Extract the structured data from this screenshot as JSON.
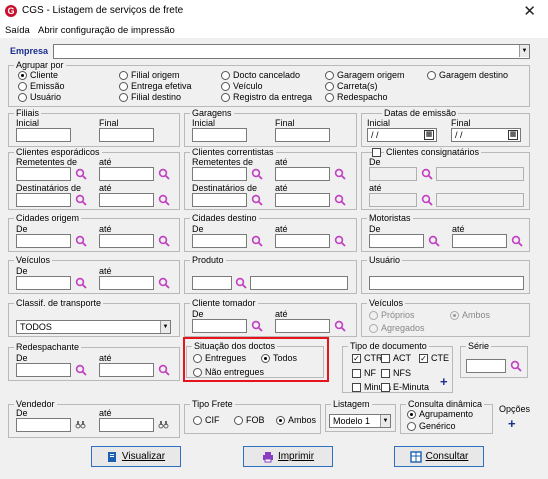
{
  "window": {
    "logo_letter": "G",
    "title": "CGS - Listagem de serviços de frete",
    "close": "✕"
  },
  "menu": {
    "items": [
      "Saída",
      "Abrir configuração de impressão"
    ]
  },
  "empresa": {
    "label": "Empresa",
    "value": ""
  },
  "agrupar": {
    "title": "Agrupar por",
    "options": [
      "Cliente",
      "Emissão",
      "Usuário",
      "Filial origem",
      "Entrega efetiva",
      "Filial destino",
      "Docto cancelado",
      "Veículo",
      "Registro da entrega",
      "Garagem origem",
      "Carreta(s)",
      "Redespacho",
      "Garagem destino"
    ],
    "selected": "Cliente"
  },
  "filiais": {
    "title": "Filiais",
    "inicial": "Inicial",
    "final": "Final"
  },
  "garagens": {
    "title": "Garagens",
    "inicial": "Inicial",
    "final": "Final"
  },
  "datas": {
    "title": "Datas de emissão",
    "inicial": "Inicial",
    "final": "Final",
    "inicial_value": "/ /",
    "final_value": "/ /"
  },
  "esporadicos": {
    "title": "Clientes esporádicos",
    "rem_de": "Remetentes  de",
    "ate": "até",
    "dest_de": "Destinatários  de"
  },
  "correntistas": {
    "title": "Clientes correntistas",
    "rem_de": "Remetentes  de",
    "ate": "até",
    "dest_de": "Destinatários  de"
  },
  "consignatarios": {
    "title": "Clientes consignatários",
    "de": "De",
    "ate": "até"
  },
  "cid_origem": {
    "title": "Cidades origem",
    "de": "De",
    "ate": "até"
  },
  "cid_destino": {
    "title": "Cidades destino",
    "de": "De",
    "ate": "até"
  },
  "motoristas": {
    "title": "Motoristas",
    "de": "De",
    "ate": "até"
  },
  "veiculos": {
    "title": "Veículos",
    "de": "De",
    "ate": "até"
  },
  "produto": {
    "title": "Produto"
  },
  "usuario": {
    "title": "Usuário"
  },
  "classif": {
    "title": "Classif. de transporte",
    "value": "TODOS"
  },
  "tomador": {
    "title": "Cliente tomador",
    "de": "De",
    "ate": "até"
  },
  "veiculos2": {
    "title": "Veículos",
    "options": [
      "Próprios",
      "Ambos",
      "Agregados"
    ],
    "selected": "Ambos"
  },
  "redespachante": {
    "title": "Redespachante",
    "de": "De",
    "ate": "até"
  },
  "situacao": {
    "title": "Situação dos doctos",
    "options": [
      "Entregues",
      "Todos",
      "Não entregues"
    ],
    "selected": "Todos"
  },
  "tipodoc": {
    "title": "Tipo de documento",
    "options": [
      {
        "label": "CTRC",
        "checked": true
      },
      {
        "label": "ACT",
        "checked": false
      },
      {
        "label": "CTE",
        "checked": true
      },
      {
        "label": "NF",
        "checked": false
      },
      {
        "label": "NFS",
        "checked": false
      },
      {
        "label": "Minuta",
        "checked": false
      },
      {
        "label": "E-Minuta",
        "checked": false
      }
    ]
  },
  "serie": {
    "title": "Série"
  },
  "vendedor": {
    "title": "Vendedor",
    "de": "De",
    "ate": "até"
  },
  "tipofrete": {
    "title": "Tipo Frete",
    "options": [
      "CIF",
      "FOB",
      "Ambos"
    ],
    "selected": "Ambos"
  },
  "listagem": {
    "title": "Listagem",
    "value": "Modelo 1"
  },
  "consulta": {
    "title": "Consulta dinâmica",
    "options": [
      "Agrupamento",
      "Genérico"
    ],
    "selected": "Agrupamento"
  },
  "opcoes": {
    "label": "Opções"
  },
  "buttons": {
    "visualizar": "Visualizar",
    "imprimir": "Imprimir",
    "consultar": "Consultar"
  },
  "colors": {
    "highlight": "#e8141b",
    "search": "#c23fc2",
    "accent": "#1a2f8f"
  }
}
